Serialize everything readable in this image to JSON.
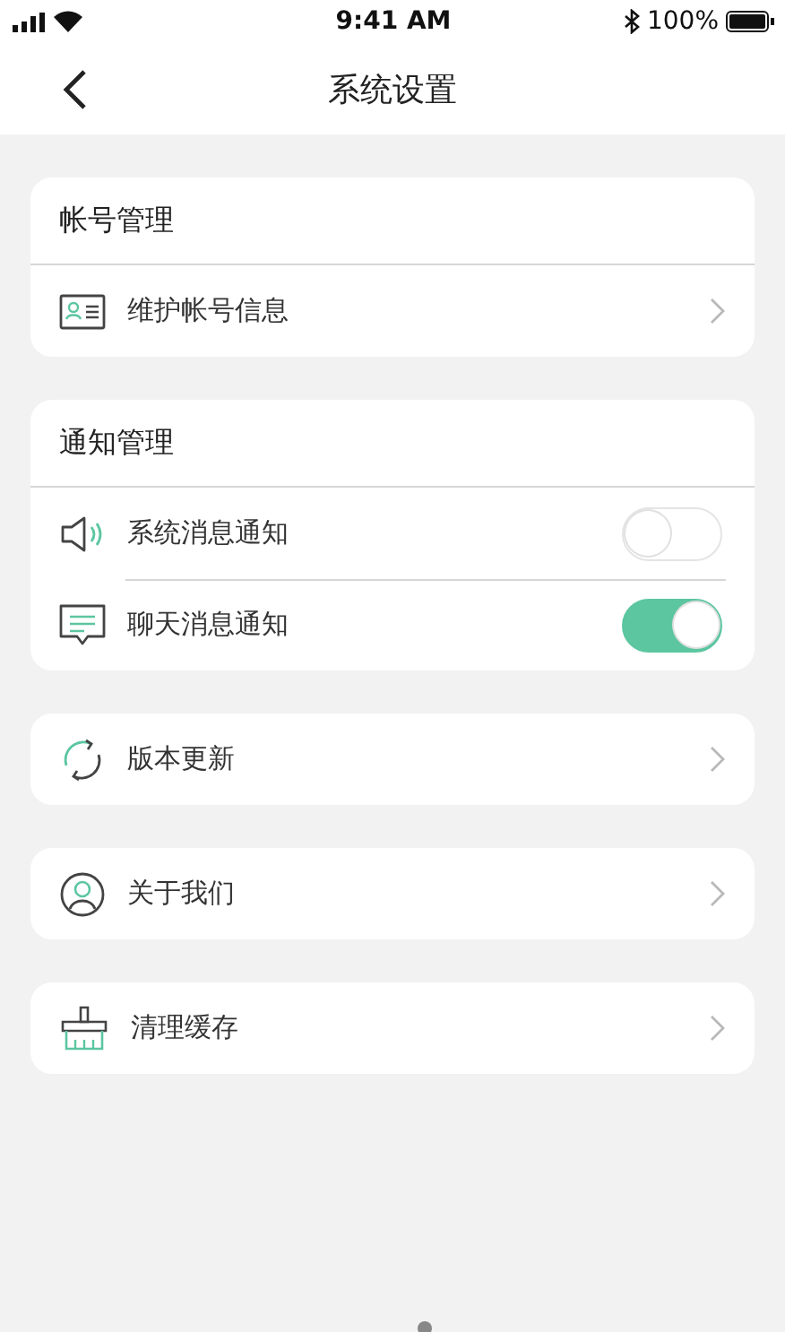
{
  "status_bar": {
    "time": "9:41 AM",
    "battery": "100%"
  },
  "nav": {
    "title": "系统设置"
  },
  "sections": [
    {
      "header": "帐号管理",
      "rows": [
        {
          "label": "维护帐号信息",
          "kind": "link"
        }
      ]
    },
    {
      "header": "通知管理",
      "rows": [
        {
          "label": "系统消息通知",
          "kind": "toggle",
          "on": false
        },
        {
          "label": "聊天消息通知",
          "kind": "toggle",
          "on": true
        }
      ]
    },
    {
      "rows": [
        {
          "label": "版本更新",
          "kind": "link"
        }
      ]
    },
    {
      "rows": [
        {
          "label": "关于我们",
          "kind": "link"
        }
      ]
    },
    {
      "rows": [
        {
          "label": "清理缓存",
          "kind": "link"
        }
      ]
    }
  ]
}
